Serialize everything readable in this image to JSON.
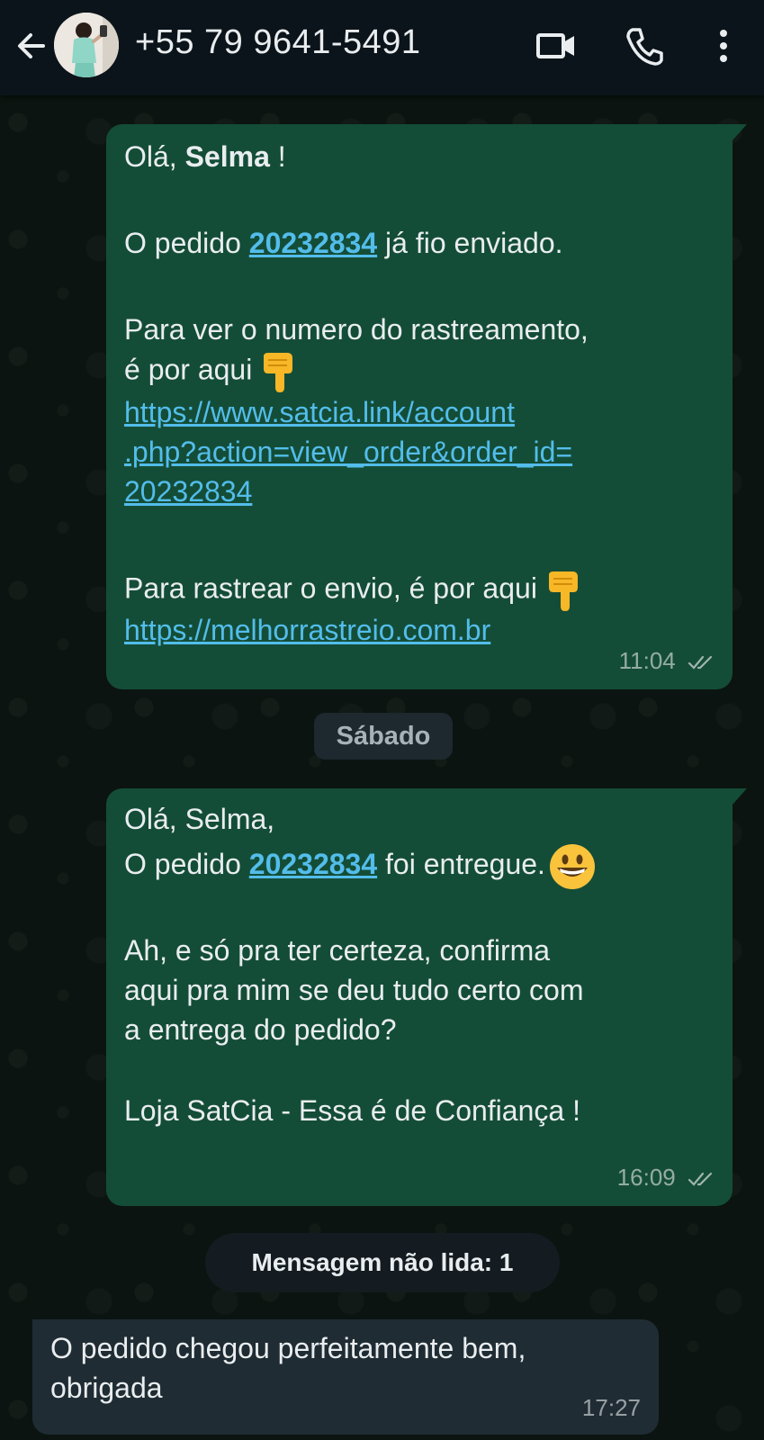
{
  "header": {
    "contact_name": "+55 79 9641-5491",
    "back_icon": "arrow-left-icon",
    "video_icon": "video-call-icon",
    "call_icon": "phone-icon",
    "menu_icon": "more-vertical-icon"
  },
  "messages": [
    {
      "direction": "outgoing",
      "greeting_prefix": "Olá, ",
      "greeting_name": "Selma",
      "greeting_suffix": " !",
      "order_prefix": "O pedido ",
      "order_number": "20232834",
      "order_suffix": " já fio enviado.",
      "tracking_line1": "Para ver o numero do rastreamento,",
      "tracking_line2": "é por aqui ",
      "account_link_line1": "https://www.satcia.link/account",
      "account_link_line2": ".php?action=view_order&order_id=",
      "account_link_line3": "20232834",
      "track_shipping": "Para rastrear o envio, é por aqui ",
      "tracking_site_link": "https://melhorrastreio.com.br",
      "time": "11:04",
      "status": "read"
    },
    {
      "direction": "outgoing",
      "greeting": "Olá, Selma,",
      "order_prefix": "O pedido ",
      "order_number": "20232834",
      "order_suffix": " foi entregue.",
      "confirm_line1": "Ah, e só pra ter certeza, confirma",
      "confirm_line2": "aqui pra mim se deu tudo certo com",
      "confirm_line3": "a entrega do pedido?",
      "signature": "Loja SatCia - Essa é de Confiança !",
      "time": "16:09",
      "status": "read"
    },
    {
      "direction": "incoming",
      "line1": "O pedido chegou perfeitamente bem,",
      "line2": "obrigada",
      "time": "17:27"
    }
  ],
  "date_separator": "Sábado",
  "unread_banner": "Mensagem não lida: 1",
  "colors": {
    "header_bg": "#0b141a",
    "outgoing_bubble": "#144d37",
    "incoming_bubble": "#1f2c33",
    "link": "#53bdeb",
    "chat_bg": "#0b1410"
  }
}
